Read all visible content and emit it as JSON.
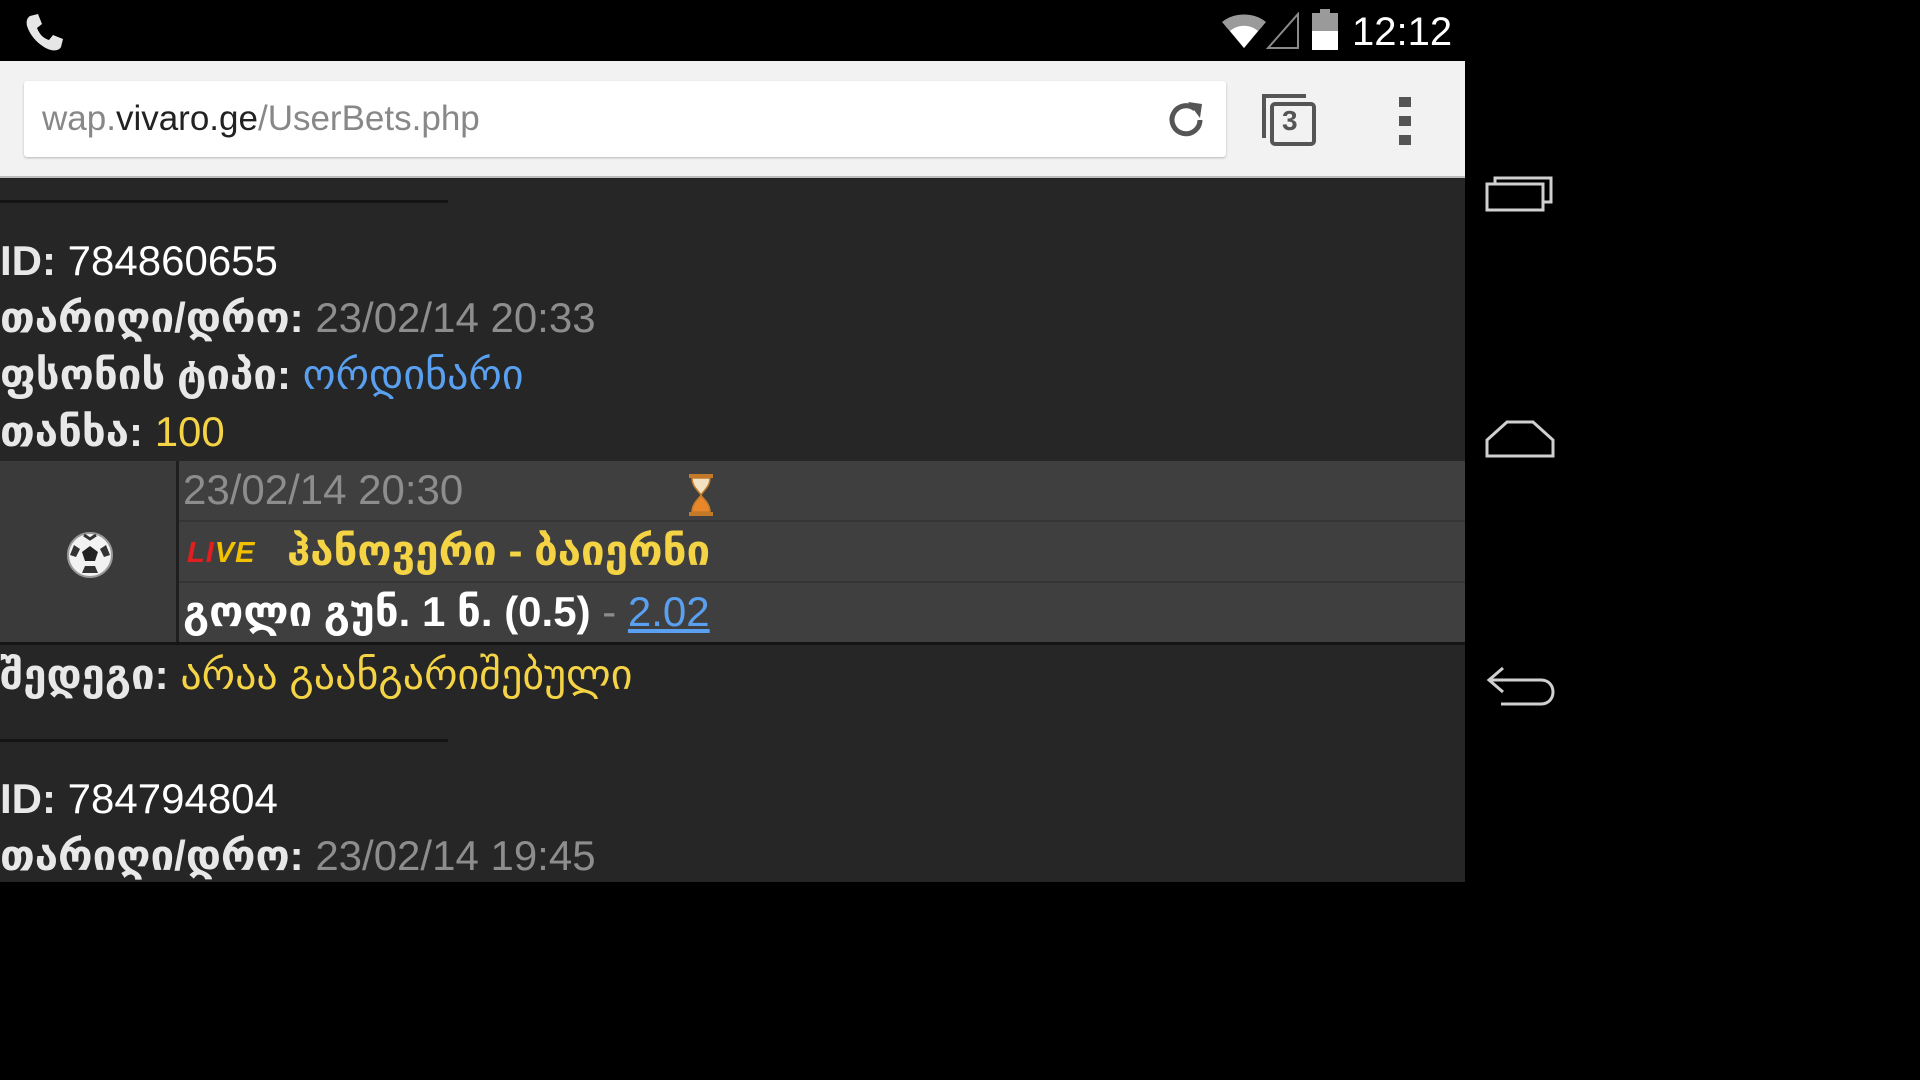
{
  "status_bar": {
    "time": "12:12"
  },
  "browser": {
    "url_prefix": "wap.",
    "url_domain": "vivaro.ge",
    "url_path": "/UserBets.php",
    "tab_count": "3"
  },
  "bets": [
    {
      "id_label": "ID:",
      "id_value": "784860655",
      "date_label": "თარიღი/დრო:",
      "date_value": "23/02/14 20:33",
      "type_label": "ფსონის ტიპი:",
      "type_value": "ორდინარი",
      "amount_label": "თანხა:",
      "amount_value": "100",
      "event": {
        "datetime": "23/02/14 20:30",
        "live_l": "LI",
        "live_ve": "VE",
        "match": "ჰანოვერი - ბაიერნი",
        "market": "გოლი გუნ. 1 ნ. (0.5)",
        "separator": "-",
        "odds": "2.02"
      },
      "result_label": "შედეგი:",
      "result_value": "არაა გაანგარიშებული"
    },
    {
      "id_label": "ID:",
      "id_value": "784794804",
      "date_label": "თარიღი/დრო:",
      "date_value": "23/02/14 19:45"
    }
  ]
}
